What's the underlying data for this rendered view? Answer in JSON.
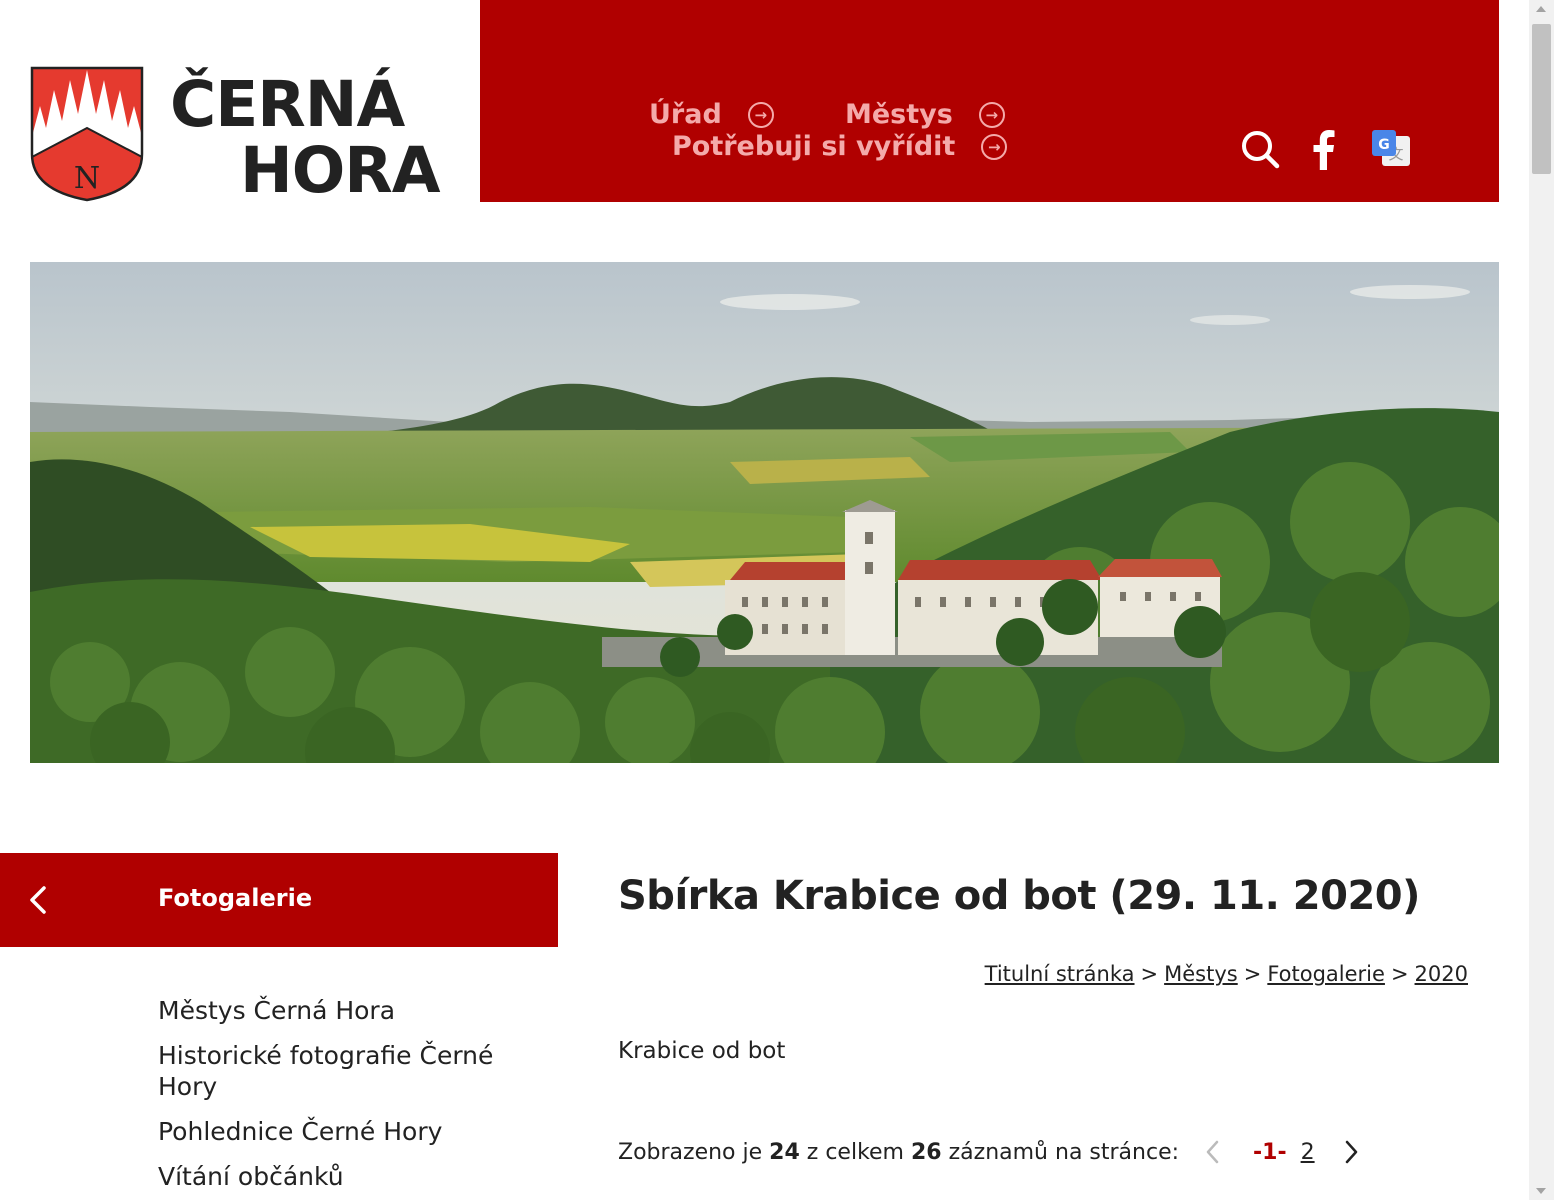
{
  "logo": {
    "line1": "ČERNÁ",
    "line2": "HORA",
    "crest_letter": "N"
  },
  "nav": {
    "items": [
      {
        "label": "Úřad"
      },
      {
        "label": "Městys"
      },
      {
        "label": "Potřebuji si vyřídit"
      }
    ],
    "icons": [
      "search-icon",
      "facebook-icon",
      "google-translate-icon"
    ]
  },
  "colors": {
    "brand_red": "#b00000",
    "nav_text": "#f4aaaa",
    "current_page": "#b00000"
  },
  "sidebar": {
    "title": "Fotogalerie",
    "items": [
      {
        "label": "Městys Černá Hora"
      },
      {
        "label": "Historické fotografie Černé Hory"
      },
      {
        "label": "Pohlednice Černé Hory"
      },
      {
        "label": "Vítání občánků"
      }
    ]
  },
  "main": {
    "title": "Sbírka Krabice od bot (29. 11. 2020)",
    "breadcrumb": [
      {
        "label": "Titulní stránka"
      },
      {
        "label": "Městys"
      },
      {
        "label": "Fotogalerie"
      },
      {
        "label": "2020"
      }
    ],
    "breadcrumb_sep": ">",
    "description": "Krabice od bot",
    "records": {
      "prefix": "Zobrazeno je",
      "shown": "24",
      "middle": "z celkem",
      "total": "26",
      "suffix": "záznamů na stránce:"
    },
    "pager": {
      "current": "-1-",
      "next_page": "2"
    }
  }
}
